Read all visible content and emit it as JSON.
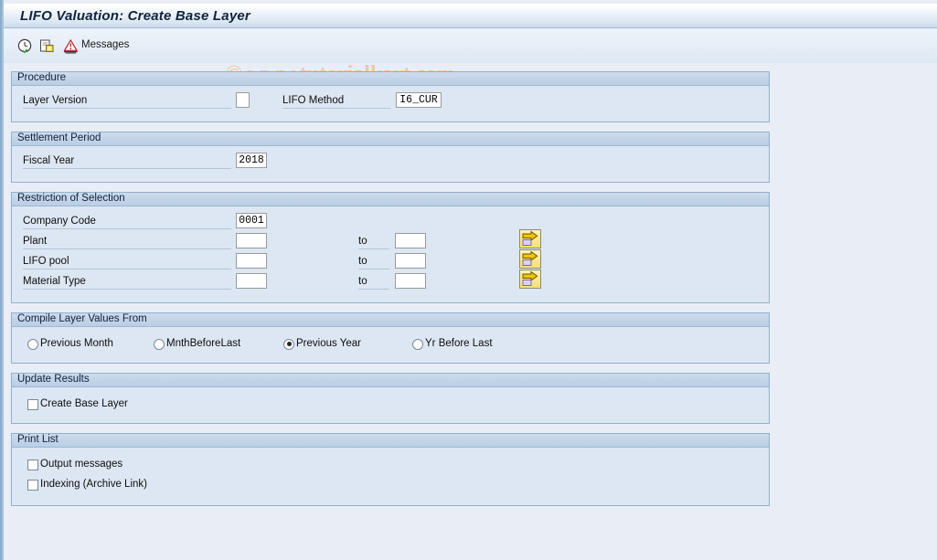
{
  "window": {
    "title": "LIFO Valuation: Create Base Layer"
  },
  "watermark": {
    "text": "© www.tutorialkart.com",
    "color": "#f0c9a0"
  },
  "toolbar": {
    "items": [
      {
        "name": "execute-icon",
        "label": ""
      },
      {
        "name": "copy-icon",
        "label": ""
      },
      {
        "name": "messages-icon",
        "label": "Messages"
      }
    ],
    "messages_label": "Messages"
  },
  "groups": {
    "procedure": {
      "title": "Procedure",
      "layer_version_label": "Layer Version",
      "layer_version_value": "",
      "lifo_method_label": "LIFO Method",
      "lifo_method_value": "I6_CUR"
    },
    "settlement_period": {
      "title": "Settlement Period",
      "fiscal_year_label": "Fiscal Year",
      "fiscal_year_value": "2018"
    },
    "restriction": {
      "title": "Restriction of Selection",
      "to_label": "to",
      "rows": [
        {
          "label": "Company Code",
          "from": "0001",
          "to": null,
          "has_arrow": false
        },
        {
          "label": "Plant",
          "from": "",
          "to": "",
          "has_arrow": true
        },
        {
          "label": "LIFO pool",
          "from": "",
          "to": "",
          "has_arrow": true
        },
        {
          "label": "Material Type",
          "from": "",
          "to": "",
          "has_arrow": true
        }
      ]
    },
    "compile": {
      "title": "Compile Layer Values From",
      "options": [
        {
          "label": "Previous Month",
          "selected": false
        },
        {
          "label": "MnthBeforeLast",
          "selected": false
        },
        {
          "label": "Previous Year",
          "selected": true
        },
        {
          "label": "Yr Before Last",
          "selected": false
        }
      ]
    },
    "update_results": {
      "title": "Update Results",
      "options": [
        {
          "label": "Create Base Layer",
          "checked": false
        }
      ]
    },
    "print_list": {
      "title": "Print List",
      "options": [
        {
          "label": "Output messages",
          "checked": false
        },
        {
          "label": "Indexing (Archive Link)",
          "checked": false
        }
      ]
    }
  },
  "colors": {
    "page_background": "#e9eef6",
    "group_background": "#dde7f3",
    "group_border": "#8fb0ce",
    "group_header": "#c3d4e8",
    "title_text": "#10233b",
    "arrow_button": "#f6e07c"
  }
}
